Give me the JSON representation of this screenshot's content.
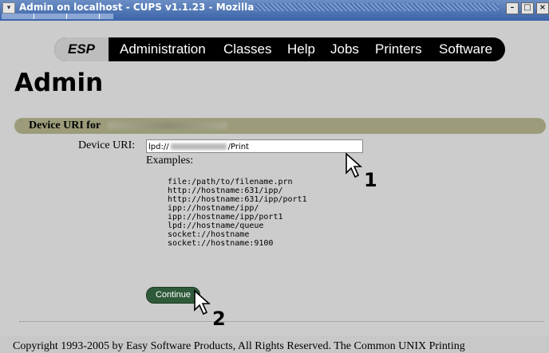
{
  "window": {
    "title": "Admin on localhost - CUPS v1.1.23 - Mozilla",
    "menu_glyph": "▾",
    "minimize_glyph": "–",
    "maximize_glyph": "□",
    "close_glyph": "×"
  },
  "nav": {
    "esp": "ESP",
    "items": [
      "Administration",
      "Classes",
      "Help",
      "Jobs",
      "Printers",
      "Software"
    ]
  },
  "page": {
    "title": "Admin",
    "section_label": "Device URI for",
    "device_uri_label": "Device URI:",
    "device_uri_prefix": "lpd://",
    "device_uri_suffix": "/Print",
    "examples_label": "Examples:",
    "examples": [
      "file:/path/to/filename.prn",
      "http://hostname:631/ipp/",
      "http://hostname:631/ipp/port1",
      "ipp://hostname/ipp/",
      "ipp://hostname/ipp/port1",
      "lpd://hostname/queue",
      "socket://hostname",
      "socket://hostname:9100"
    ],
    "continue_label": "Continue",
    "copyright": "Copyright 1993-2005 by Easy Software Products, All Rights Reserved. The Common UNIX Printing"
  },
  "callouts": {
    "one": "1",
    "two": "2"
  },
  "colors": {
    "titlebar": "#3a63a8",
    "navbar": "#000000",
    "section_bar": "#9c9c7a",
    "continue_button": "#2f5a3a"
  }
}
